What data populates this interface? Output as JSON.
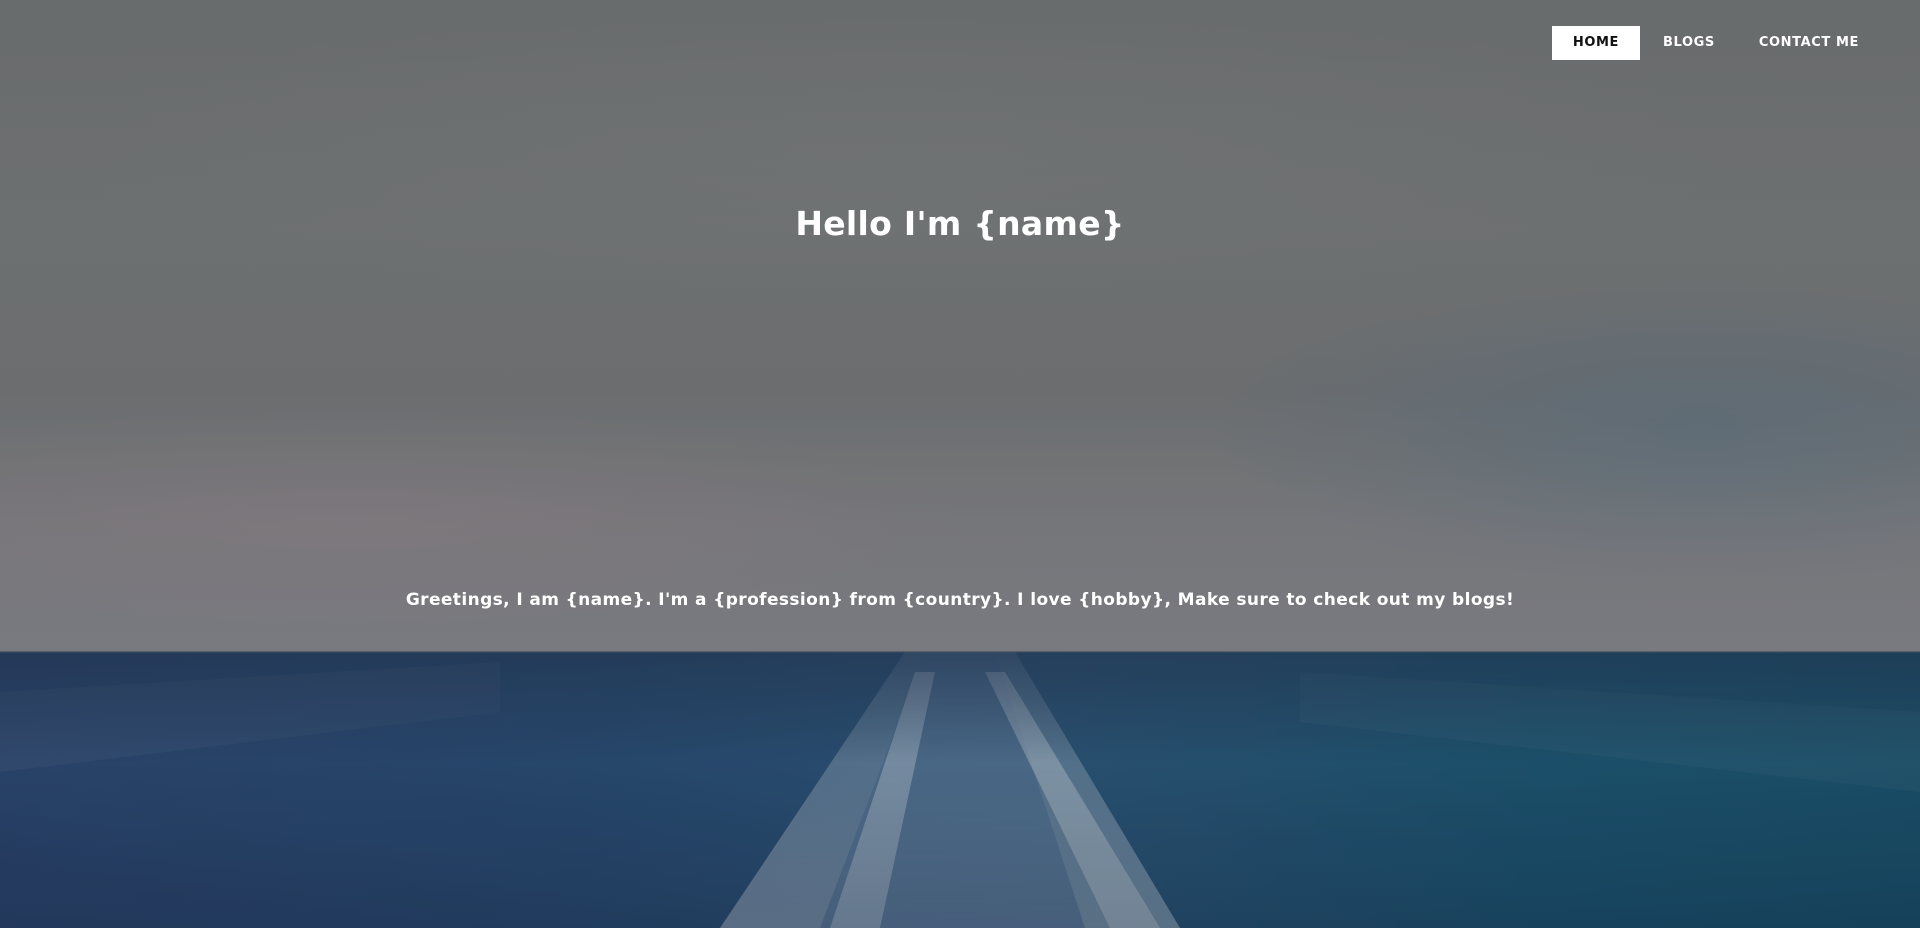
{
  "nav": {
    "items": [
      {
        "label": "HOME",
        "active": true
      },
      {
        "label": "BLOGS",
        "active": false
      },
      {
        "label": "CONTACT ME",
        "active": false
      }
    ]
  },
  "hero": {
    "title": "Hello I'm {name}",
    "subtitle": "Greetings, I am {name}. I'm a {profession} from {country}. I love {hobby}, Make sure to check out my blogs!",
    "background": {
      "description_icon": "ocean-wake-background",
      "sky_color": "#7b7f80",
      "sea_color": "#2c5079"
    }
  }
}
